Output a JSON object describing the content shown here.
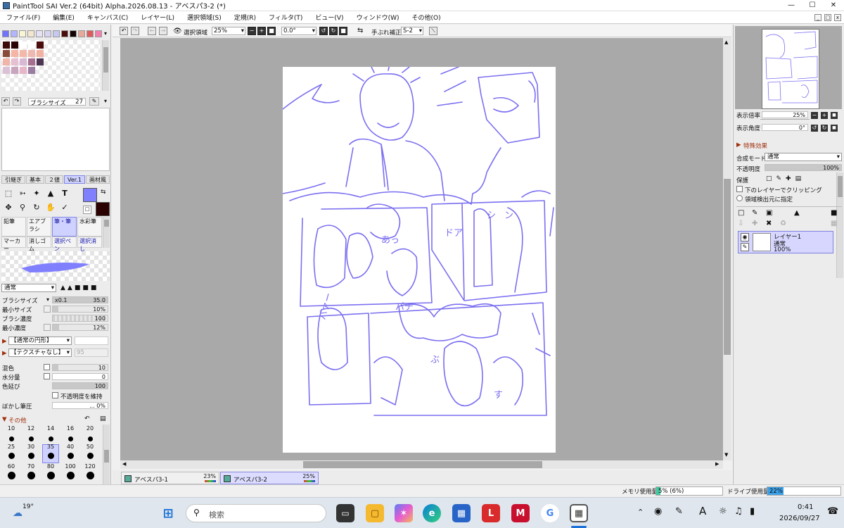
{
  "window": {
    "title": "PaintTool SAI Ver.2 (64bit) Alpha.2026.08.13 - アベスパ3-2 (*)"
  },
  "menu": [
    "ファイル(F)",
    "編集(E)",
    "キャンバス(C)",
    "レイヤー(L)",
    "選択領域(S)",
    "定規(R)",
    "フィルタ(T)",
    "ビュー(V)",
    "ウィンドウ(W)",
    "その他(O)"
  ],
  "colors": {
    "accent": "#7f7fff",
    "main_color": "#8080ff",
    "sub_color": "#2a0000",
    "line_color": "#7b6ff0",
    "selected_tab": "#cfd2ff"
  },
  "palette_top": [
    "#6f74ff",
    "#b3b6ff",
    "#f9f6d6",
    "#f5e6cf",
    "#e6e1f5",
    "#d7d4f2",
    "#c5c8ef",
    "#4a0b0b",
    "#120303",
    "#e6a99a",
    "#e05b5b",
    "#f27fae"
  ],
  "swatches_grid": [
    "#3b0a0a",
    "#2b0505",
    "#ffffff",
    "#ffffff",
    "#4a0c0c",
    "#8a4a3a",
    "#f5b4a4",
    "#f3b8aa",
    "#efb8b0",
    "#f2b1a1",
    "#f1b4a9",
    "#e7bfd2",
    "#d9b8d3",
    "#a66f91",
    "#4b3552",
    "#dbc1d6",
    "#c8a4bd",
    "#e7b6c8",
    "#9a7ca0"
  ],
  "history": {
    "brush_size_label": "ブラシサイズ",
    "brush_size_value": "27"
  },
  "tool_tabs": [
    "引継ぎ",
    "基本",
    "２値",
    "Ver.1",
    "画材風"
  ],
  "tool_tab_selected": "Ver.1",
  "tools": {
    "text_icon": "T"
  },
  "brush_cells": [
    {
      "label": "鉛筆",
      "selected": false
    },
    {
      "label": "エアブラシ",
      "selected": false
    },
    {
      "label": "筆・筆",
      "selected": true
    },
    {
      "label": "水彩筆",
      "selected": false
    }
  ],
  "brush_cells_row2": [
    "マーカー",
    "消しゴム",
    "選択ペン",
    "選択消し"
  ],
  "brush_settings": {
    "blend_mode": "通常",
    "brush_size_label": "ブラシサイズ",
    "brush_size_mult": "x0.1",
    "brush_size_value": "35.0",
    "min_size_label": "最小サイズ",
    "min_size_value": "10%",
    "density_label": "ブラシ濃度",
    "density_value": "100",
    "min_density_label": "最小濃度",
    "min_density_value": "12%",
    "shape": "【通常の円形】",
    "texture": "【テクスチャなし】",
    "texture_value": "95",
    "mix_label": "混色",
    "mix_value": "10",
    "water_label": "水分量",
    "water_value": "0",
    "stretch_label": "色延び",
    "stretch_value": "100",
    "keep_opacity_label": "不透明度を維持",
    "blur_label": "ぼかし筆圧",
    "blur_value": "... 0%",
    "other_label": "その他"
  },
  "size_labels": [
    "10",
    "12",
    "14",
    "16",
    "20",
    "25",
    "30",
    "35",
    "40",
    "50",
    "60",
    "70",
    "80",
    "100",
    "120"
  ],
  "size_selected": "35",
  "toolbar": {
    "selection_label": "選択領域",
    "zoom_value": "25%",
    "angle_value": "0.0°",
    "stabilizer_label": "手ぶれ補正",
    "stabilizer_value": "S-2"
  },
  "doc_tabs": [
    {
      "name": "アベスパ3-1",
      "zoom": "23%",
      "selected": false
    },
    {
      "name": "アベスパ3-2",
      "zoom": "25%",
      "selected": true
    }
  ],
  "navigator": {
    "zoom_label": "表示倍率",
    "zoom_value": "25%",
    "angle_label": "表示角度",
    "angle_value": "0°"
  },
  "layer_panel": {
    "effects_label": "特殊効果",
    "blend_label": "合成モード",
    "blend_value": "通常",
    "opacity_label": "不透明度",
    "opacity_value": "100%",
    "protect_label": "保護",
    "clip_label": "下のレイヤーでクリッピング",
    "source_label": "領域検出元に指定"
  },
  "layers": [
    {
      "name": "レイヤー1",
      "mode": "通常",
      "opacity": "100%"
    }
  ],
  "status": {
    "memory_label": "メモリ使用量",
    "memory_value": "5% (6%)",
    "memory_level": 0.06,
    "drive_label": "ドライブ使用量",
    "drive_value": "22%",
    "drive_level": 0.22
  },
  "taskbar": {
    "temperature": "19°",
    "search_placeholder": "検索",
    "time": "0:41",
    "date": "2026/09/27",
    "ime_glyph": "A"
  },
  "sketch_text": [
    "ドア",
    "バァー",
    "パチ",
    "あっ",
    "ぶ",
    "す",
    "シ",
    "ン"
  ]
}
